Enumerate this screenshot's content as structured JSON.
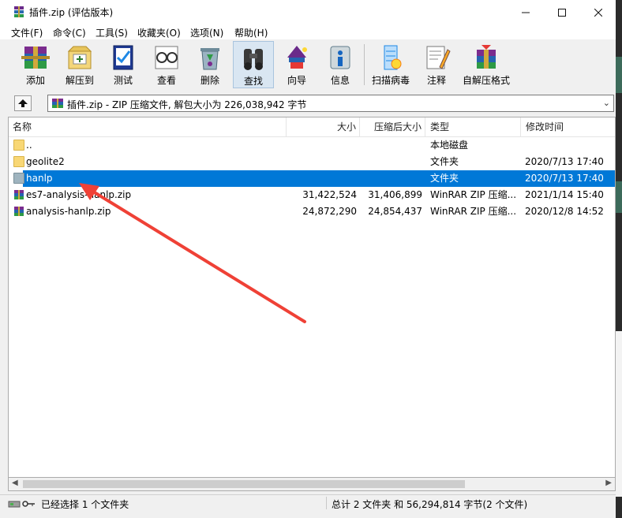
{
  "window": {
    "title": "插件.zip (评估版本)"
  },
  "menu": [
    "文件(F)",
    "命令(C)",
    "工具(S)",
    "收藏夹(O)",
    "选项(N)",
    "帮助(H)"
  ],
  "toolbar": [
    {
      "label": "添加",
      "icon": "add-archive-icon"
    },
    {
      "label": "解压到",
      "icon": "extract-to-icon"
    },
    {
      "label": "测试",
      "icon": "test-icon"
    },
    {
      "label": "查看",
      "icon": "view-icon"
    },
    {
      "label": "删除",
      "icon": "delete-icon"
    },
    {
      "label": "查找",
      "icon": "find-icon",
      "active": true
    },
    {
      "label": "向导",
      "icon": "wizard-icon"
    },
    {
      "label": "信息",
      "icon": "info-icon"
    },
    {
      "label": "扫描病毒",
      "icon": "scan-virus-icon"
    },
    {
      "label": "注释",
      "icon": "comment-icon"
    },
    {
      "label": "自解压格式",
      "icon": "sfx-icon"
    }
  ],
  "path": {
    "text": "插件.zip - ZIP 压缩文件, 解包大小为 226,038,942 字节"
  },
  "columns": {
    "name": "名称",
    "size": "大小",
    "packed": "压缩后大小",
    "type": "类型",
    "modified": "修改时间"
  },
  "rows": [
    {
      "name": "..",
      "size": "",
      "packed": "",
      "type": "本地磁盘",
      "modified": "",
      "icon": "folder"
    },
    {
      "name": "geolite2",
      "size": "",
      "packed": "",
      "type": "文件夹",
      "modified": "2020/7/13 17:40",
      "icon": "folder"
    },
    {
      "name": "hanlp",
      "size": "",
      "packed": "",
      "type": "文件夹",
      "modified": "2020/7/13 17:40",
      "icon": "folder-gray",
      "selected": true
    },
    {
      "name": "es7-analysis-hanlp.zip",
      "size": "31,422,524",
      "packed": "31,406,899",
      "type": "WinRAR ZIP 压缩...",
      "modified": "2021/1/14 15:40",
      "icon": "winrar"
    },
    {
      "name": "analysis-hanlp.zip",
      "size": "24,872,290",
      "packed": "24,854,437",
      "type": "WinRAR ZIP 压缩...",
      "modified": "2020/12/8 14:52",
      "icon": "winrar"
    }
  ],
  "status": {
    "selection": "已经选择 1 个文件夹",
    "total": "总计 2 文件夹 和 56,294,814 字节(2 个文件)"
  },
  "colors": {
    "selection": "#0078d7",
    "arrow": "#ef4136"
  }
}
